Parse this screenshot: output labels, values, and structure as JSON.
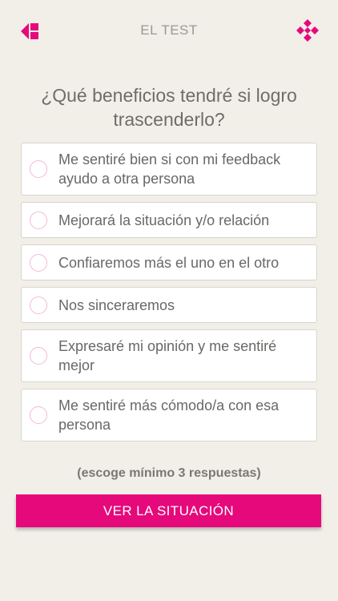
{
  "colors": {
    "accent": "#e6097b",
    "radio_border": "#f4b8d7",
    "background": "#f2efe9"
  },
  "header": {
    "title": "EL TEST",
    "back_icon": "back-arrow-icon",
    "menu_icon": "diamond-grid-icon"
  },
  "question": "¿Qué beneficios tendré si logro trascenderlo?",
  "options": [
    {
      "label": "Me sentiré bien si con mi feedback ayudo a otra persona",
      "selected": false
    },
    {
      "label": "Mejorará la situación y/o relación",
      "selected": false
    },
    {
      "label": "Confiaremos más el uno en el otro",
      "selected": false
    },
    {
      "label": "Nos sinceraremos",
      "selected": false
    },
    {
      "label": "Expresaré mi opinión y me sentiré mejor",
      "selected": false
    },
    {
      "label": "Me sentiré más cómodo/a con esa persona",
      "selected": false
    }
  ],
  "hint": "(escoge mínimo 3 respuestas)",
  "cta_label": "VER LA SITUACIÓN"
}
